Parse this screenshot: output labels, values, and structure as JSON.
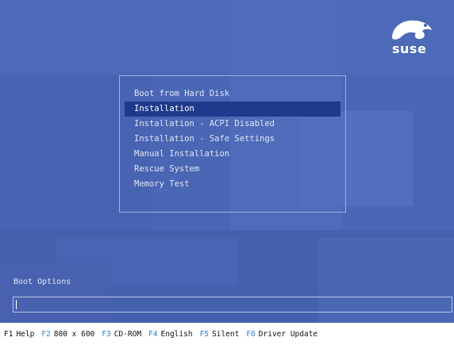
{
  "logo": {
    "text": "suse",
    "icon": "suse-chameleon-icon"
  },
  "menu": {
    "items": [
      "Boot from Hard Disk",
      "Installation",
      "Installation - ACPI Disabled",
      "Installation - Safe Settings",
      "Manual Installation",
      "Rescue System",
      "Memory Test"
    ],
    "selected_index": 1
  },
  "boot_options": {
    "label": "Boot Options",
    "value": ""
  },
  "fkeys": [
    {
      "key": "F1",
      "label": "Help"
    },
    {
      "key": "F2",
      "label": "800 x 600"
    },
    {
      "key": "F3",
      "label": "CD-ROM"
    },
    {
      "key": "F4",
      "label": "English"
    },
    {
      "key": "F5",
      "label": "Silent"
    },
    {
      "key": "F6",
      "label": "Driver Update"
    }
  ],
  "colors": {
    "background": "#4a66b4",
    "selection": "#1e3a8c",
    "fkey_accent": "#2f7fc9"
  }
}
